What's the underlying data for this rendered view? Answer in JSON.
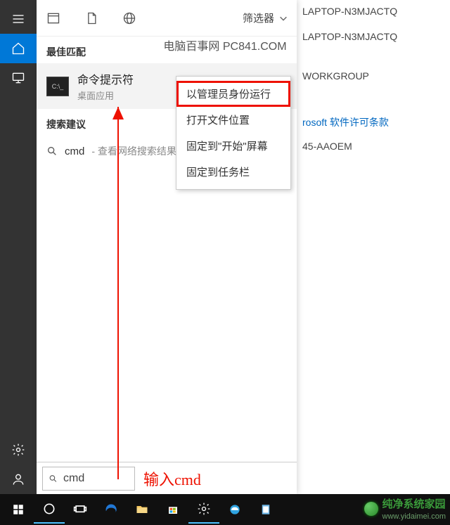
{
  "watermark": "电脑百事网 PC841.COM",
  "rail": {
    "icons": [
      "menu",
      "home",
      "monitor",
      "gear",
      "user"
    ]
  },
  "panel_top": {
    "icons": [
      "window",
      "page",
      "globe"
    ],
    "filter_label": "筛选器"
  },
  "sections": {
    "best_match": "最佳匹配",
    "search_suggestion": "搜索建议"
  },
  "best_match": {
    "title": "命令提示符",
    "subtitle": "桌面应用",
    "thumb_text": "C:\\_"
  },
  "suggestion": {
    "query": "cmd",
    "suffix": " - 查看网络搜索结果"
  },
  "context_menu": {
    "items": [
      "以管理员身份运行",
      "打开文件位置",
      "固定到\"开始\"屏幕",
      "固定到任务栏"
    ],
    "highlighted_index": 0
  },
  "search_input": {
    "value": "cmd"
  },
  "annotations": {
    "input_label": "输入cmd"
  },
  "background_info": [
    {
      "t": "text",
      "v": "LAPTOP-N3MJACTQ"
    },
    {
      "t": "text",
      "v": "LAPTOP-N3MJACTQ"
    },
    {
      "t": "text",
      "v": "WORKGROUP"
    },
    {
      "t": "link",
      "v": "rosoft 软件许可条款"
    },
    {
      "t": "text",
      "v": "45-AAOEM"
    }
  ],
  "taskbar": {
    "items": [
      {
        "name": "start",
        "active": false
      },
      {
        "name": "cortana",
        "active": true
      },
      {
        "name": "taskview",
        "active": false
      },
      {
        "name": "edge",
        "active": false
      },
      {
        "name": "explorer",
        "active": false
      },
      {
        "name": "store",
        "active": false
      },
      {
        "name": "settings",
        "active": true
      },
      {
        "name": "ie",
        "active": false
      },
      {
        "name": "notepad",
        "active": false
      }
    ]
  },
  "brand": {
    "name": "纯净系统家园",
    "url": "www.yidaimei.com"
  }
}
